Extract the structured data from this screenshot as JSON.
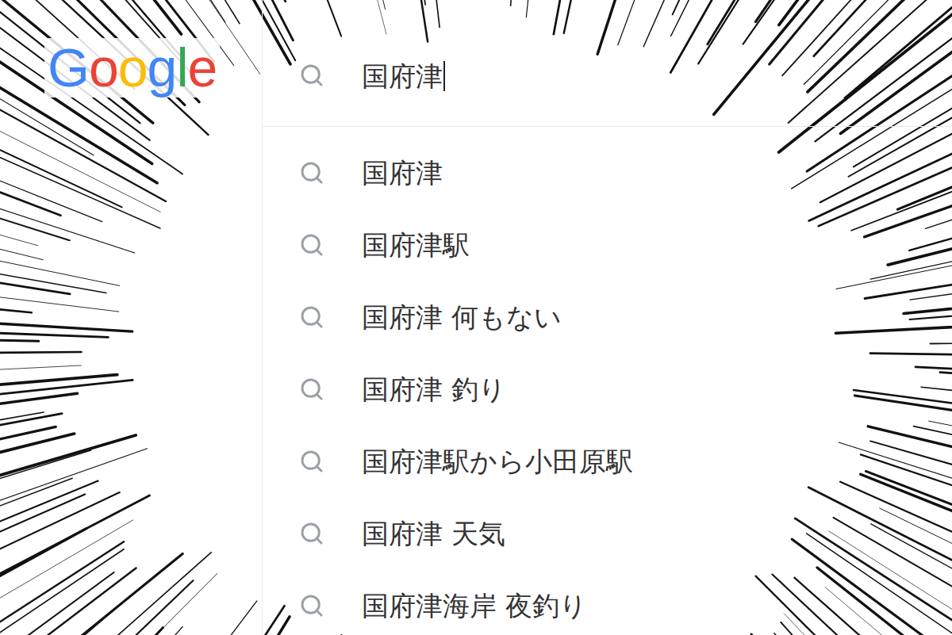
{
  "logo": "Google",
  "search": {
    "query": "国府津",
    "caret": true
  },
  "suggestions": [
    {
      "text": "国府津"
    },
    {
      "text": "国府津駅"
    },
    {
      "text": "国府津 何もない"
    },
    {
      "text": "国府津 釣り"
    },
    {
      "text": "国府津駅から小田原駅"
    },
    {
      "text": "国府津 天気"
    },
    {
      "text": "国府津海岸 夜釣り"
    }
  ]
}
